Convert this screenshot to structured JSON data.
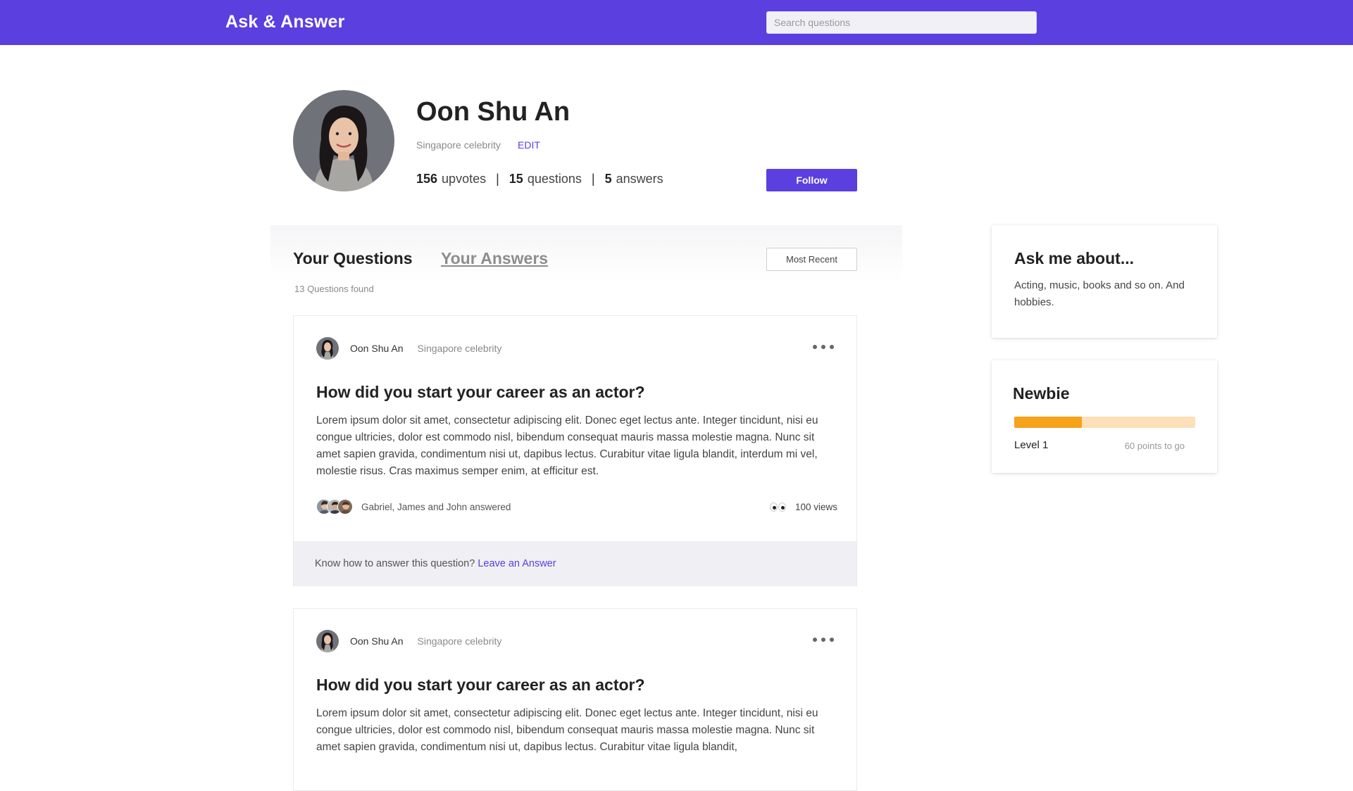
{
  "header": {
    "brand": "Ask & Answer",
    "search_placeholder": "Search questions"
  },
  "profile": {
    "name": "Oon Shu An",
    "title": "Singapore celebrity",
    "edit_label": "EDIT",
    "upvotes_count": "156",
    "upvotes_label": "upvotes",
    "questions_count": "15",
    "questions_label": "questions",
    "answers_count": "5",
    "answers_label": "answers",
    "follow_label": "Follow"
  },
  "tabs": {
    "active": "Your Questions",
    "inactive": "Your Answers",
    "sort_label": "Most Recent",
    "found_text": "13 Questions found"
  },
  "questions": [
    {
      "author": "Oon Shu An",
      "author_title": "Singapore celebrity",
      "title": "How did you start your career as an actor?",
      "body": "Lorem ipsum dolor sit amet, consectetur adipiscing elit. Donec eget lectus ante. Integer tincidunt, nisi eu congue ultricies, dolor est commodo nisl, bibendum consequat mauris massa molestie magna. Nunc sit amet sapien gravida, condimentum nisi ut, dapibus lectus. Curabitur vitae ligula blandit, interdum mi vel, molestie risus. Cras maximus semper enim, at efficitur est.",
      "answered_by": "Gabriel, James and John answered",
      "views": "100 views",
      "answer_prompt": "Know how to answer this question?",
      "answer_link": "Leave an Answer"
    },
    {
      "author": "Oon Shu An",
      "author_title": "Singapore celebrity",
      "title": "How did you start your career as an actor?",
      "body": "Lorem ipsum dolor sit amet, consectetur adipiscing elit. Donec eget lectus ante. Integer tincidunt, nisi eu congue ultricies, dolor est commodo nisl, bibendum consequat mauris massa molestie magna. Nunc sit amet sapien gravida, condimentum nisi ut, dapibus lectus. Curabitur vitae ligula blandit,"
    }
  ],
  "sidebar": {
    "about_title": "Ask me about...",
    "about_text": "Acting, music, books and so on. And hobbies.",
    "rank_title": "Newbie",
    "level_label": "Level 1",
    "points_label": "60 points to go",
    "progress_fraction": 0.375
  },
  "colors": {
    "brand": "#5b3fdf",
    "progress_fill": "#f6a21b",
    "progress_track": "#fde0b8"
  }
}
